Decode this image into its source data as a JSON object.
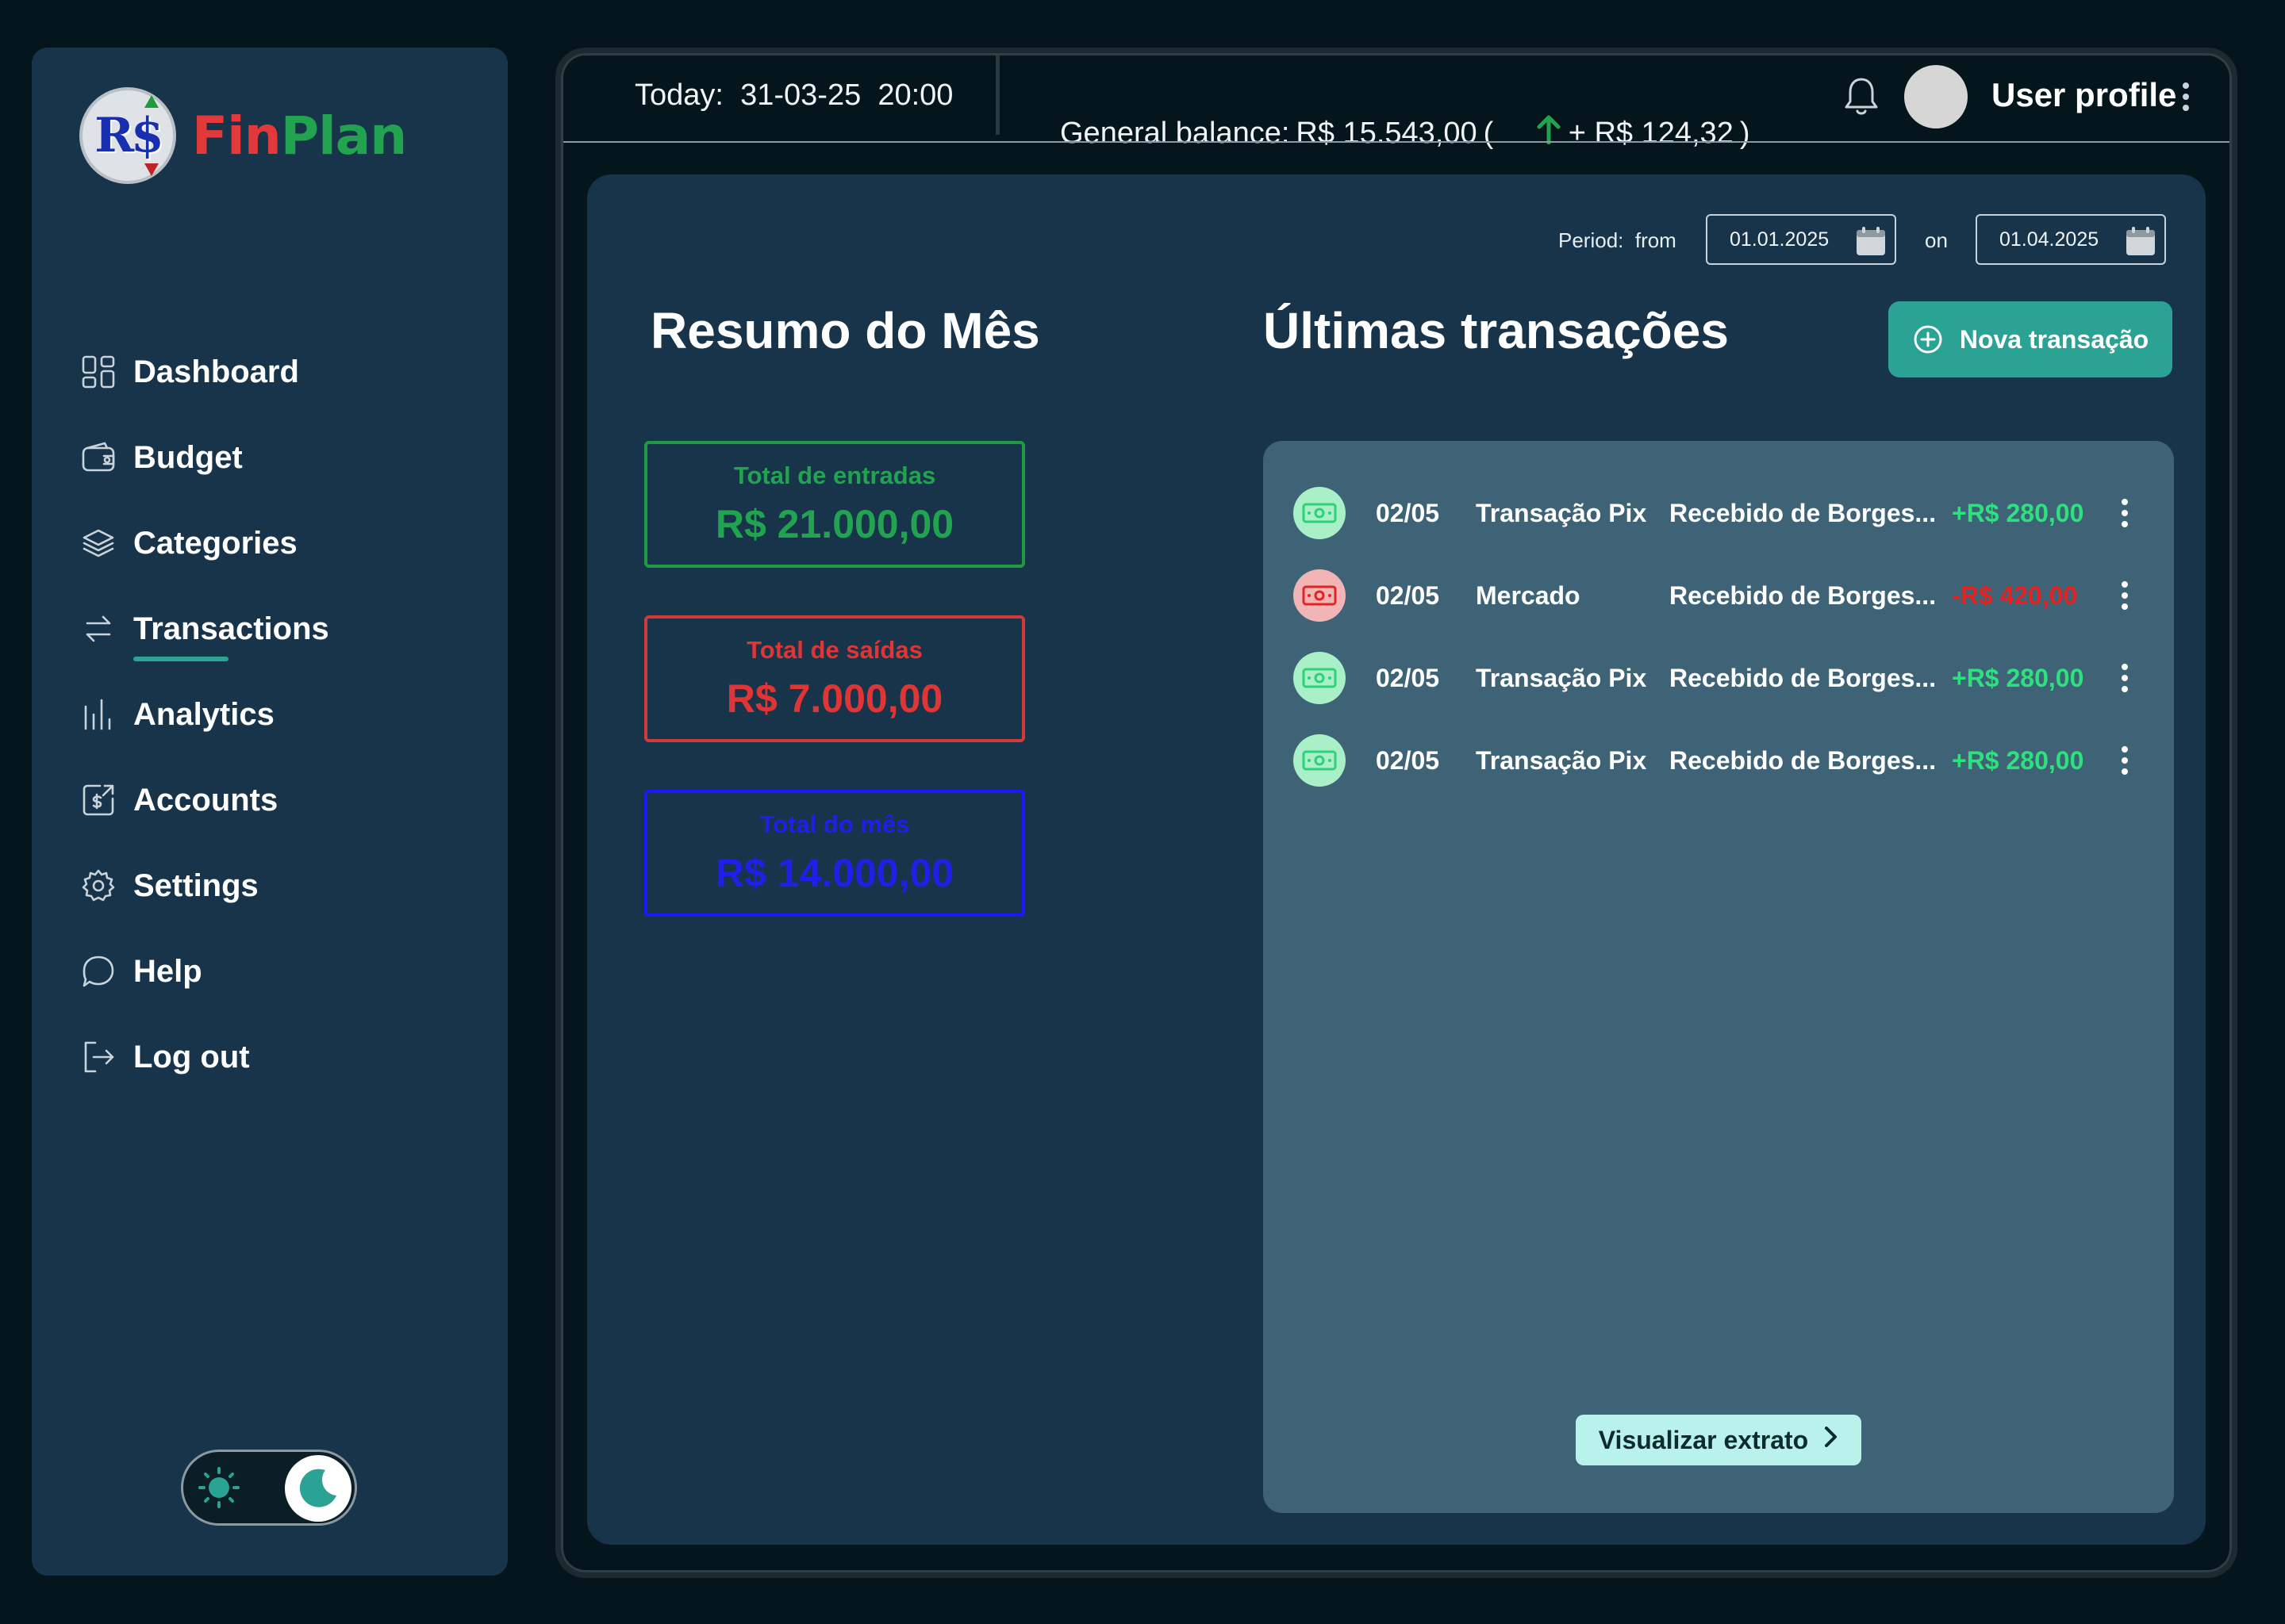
{
  "brand": {
    "name_part1": "Fin",
    "name_part2": "Plan",
    "logo_glyph": "R$",
    "logo_icon": "currency-logo-icon"
  },
  "sidebar": {
    "items": [
      {
        "label": "Dashboard",
        "icon": "dashboard-grid-icon"
      },
      {
        "label": "Budget",
        "icon": "wallet-icon"
      },
      {
        "label": "Categories",
        "icon": "layers-icon"
      },
      {
        "label": "Transactions",
        "icon": "transfer-arrows-icon",
        "active": true
      },
      {
        "label": "Analytics",
        "icon": "bar-chart-icon"
      },
      {
        "label": "Accounts",
        "icon": "dollar-account-icon"
      },
      {
        "label": "Settings",
        "icon": "gear-icon"
      },
      {
        "label": "Help",
        "icon": "chat-bubble-icon"
      },
      {
        "label": "Log out",
        "icon": "logout-icon"
      }
    ],
    "theme": {
      "current": "dark",
      "light_icon": "sun-icon",
      "dark_icon": "moon-icon"
    }
  },
  "header": {
    "today_label": "Today:",
    "today_date": "31-03-25",
    "today_time": "20:00",
    "balance_label": "General balance:",
    "balance_value": "R$ 15.543,00",
    "balance_open": "(",
    "balance_change": "+ R$ 124,32",
    "balance_close": ")",
    "profile_label": "User profile"
  },
  "period": {
    "label": "Period:",
    "from_label": "from",
    "from": "01.01.2025",
    "on_label": "on",
    "to": "01.04.2025"
  },
  "summary": {
    "title": "Resumo do Mês",
    "income": {
      "label": "Total de entradas",
      "value": "R$ 21.000,00"
    },
    "expenses": {
      "label": "Total de saídas",
      "value": "R$ 7.000,00"
    },
    "total": {
      "label": "Total do mês",
      "value": "R$ 14.000,00"
    }
  },
  "transactions": {
    "title": "Últimas transações",
    "new_button": "Nova transação",
    "view_statement": "Visualizar extrato",
    "rows": [
      {
        "date": "02/05",
        "description": "Transação Pix",
        "note": "Recebido de Borges...",
        "amount": "+R$ 280,00",
        "type": "in"
      },
      {
        "date": "02/05",
        "description": "Mercado",
        "note": "Recebido de Borges...",
        "amount": "-R$ 420,00",
        "type": "out"
      },
      {
        "date": "02/05",
        "description": "Transação Pix",
        "note": "Recebido de Borges...",
        "amount": "+R$ 280,00",
        "type": "in"
      },
      {
        "date": "02/05",
        "description": "Transação Pix",
        "note": "Recebido de Borges...",
        "amount": "+R$ 280,00",
        "type": "in"
      }
    ]
  },
  "colors": {
    "background": "#04161b",
    "panel": "#18344a",
    "tx_panel": "#3e6377",
    "accent": "#2aa294",
    "income": "#22a350",
    "expense": "#df3535",
    "total": "#1f1fe8"
  }
}
